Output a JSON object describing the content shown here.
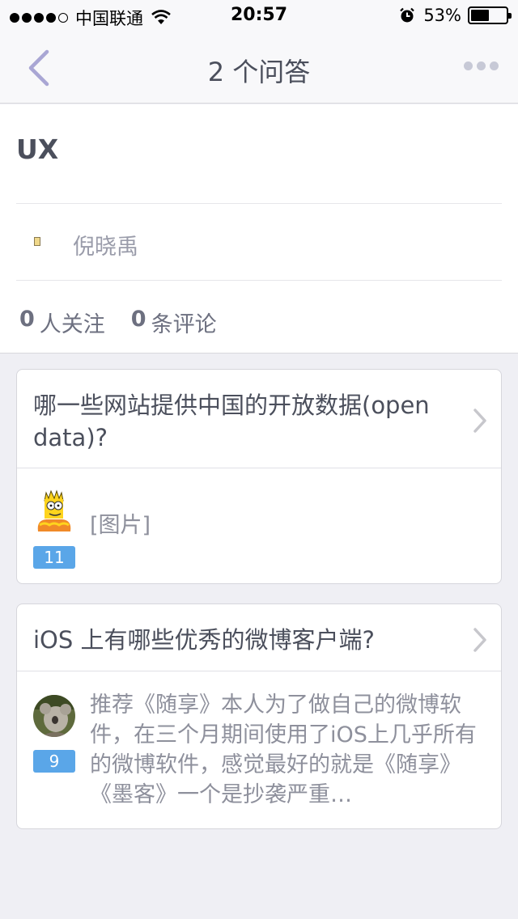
{
  "status_bar": {
    "carrier": "中国联通",
    "time": "20:57",
    "battery": "53%",
    "battery_level": 0.53
  },
  "nav": {
    "title": "2 个问答"
  },
  "topic": {
    "title": "UX",
    "author": "倪晓禹",
    "followers_count": "0",
    "followers_label": "人关注",
    "comments_count": "0",
    "comments_label": "条评论"
  },
  "answers": [
    {
      "question": "哪一些网站提供中国的开放数据(open data)?",
      "votes": "11",
      "excerpt": "[图片]",
      "avatar": "bart-simpson-avatar"
    },
    {
      "question": "iOS 上有哪些优秀的微博客户端?",
      "votes": "9",
      "excerpt": "推荐《随享》本人为了做自己的微博软件，在三个月期间使用了iOS上几乎所有的微博软件，感觉最好的就是《随享》《墨客》一个是抄袭严重…",
      "avatar": "koala-photo-avatar"
    }
  ]
}
